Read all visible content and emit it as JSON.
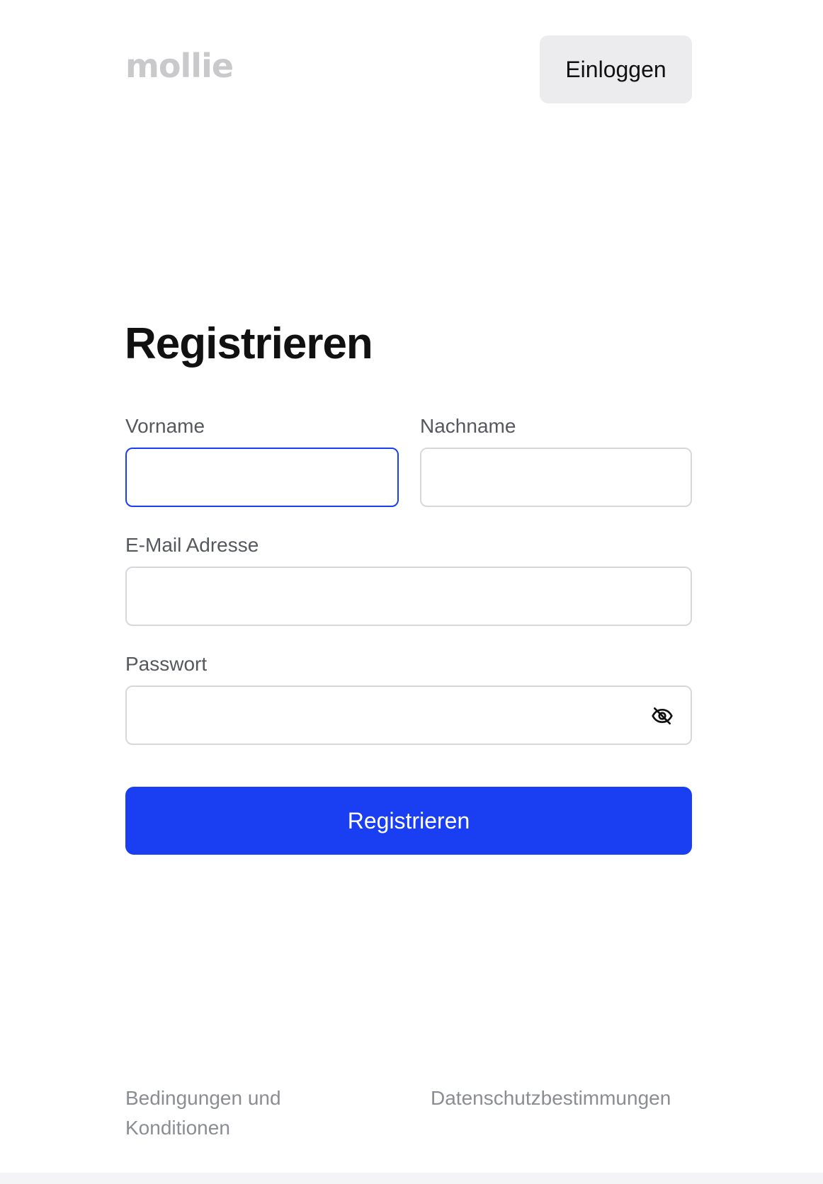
{
  "header": {
    "logo_text": "mollie",
    "login_label": "Einloggen"
  },
  "form": {
    "title": "Registrieren",
    "first_name": {
      "label": "Vorname",
      "value": "",
      "focused": true
    },
    "last_name": {
      "label": "Nachname",
      "value": ""
    },
    "email": {
      "label": "E-Mail Adresse",
      "value": ""
    },
    "password": {
      "label": "Passwort",
      "value": "",
      "toggle_icon": "eye-off-icon"
    },
    "submit_label": "Registrieren"
  },
  "footer": {
    "terms_label": "Bedingungen und Konditionen",
    "privacy_label": "Datenschutzbestimmungen"
  },
  "colors": {
    "accent": "#1a3ef2",
    "secondary_button_bg": "#ececef",
    "logo": "#c9c9cc",
    "label": "#55585e",
    "footer_link": "#8a8d93",
    "input_border": "#d8d8dc"
  }
}
